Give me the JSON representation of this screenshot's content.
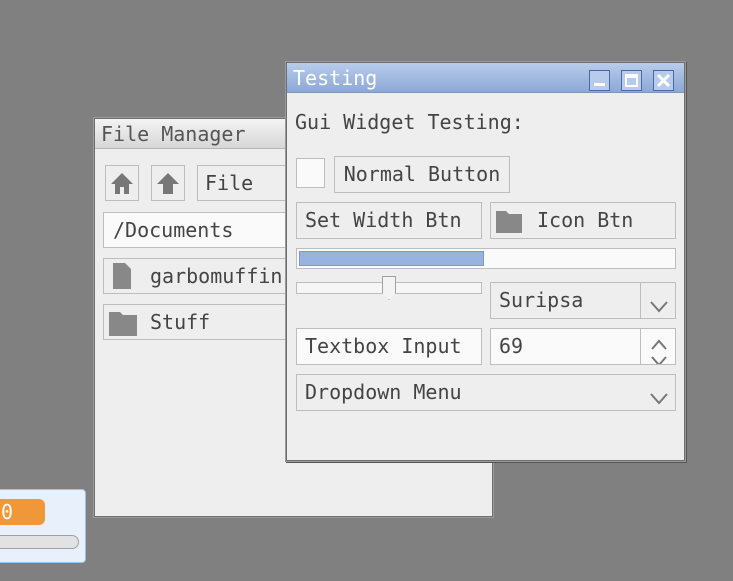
{
  "file_manager": {
    "title": "File Manager",
    "toolbar": {
      "home_icon": "home-icon",
      "up_icon": "up-arrow-icon",
      "path_field": "File"
    },
    "location": "/Documents",
    "items": [
      {
        "icon": "file-icon",
        "label": "garbomuffin"
      },
      {
        "icon": "folder-icon",
        "label": "Stuff"
      }
    ]
  },
  "testing_window": {
    "title": "Testing",
    "heading": "Gui Widget Testing:",
    "controls": {
      "minimize": "minimize-icon",
      "maximize": "maximize-icon",
      "close": "close-icon"
    },
    "normal_button": "Normal Button",
    "set_width_button": "Set Width Btn",
    "icon_button": "Icon Btn",
    "progress": 0.5,
    "slider_value": 0.5,
    "select_value": "Suripsa",
    "textbox_value": "Textbox Input",
    "number_value": "69",
    "dropdown_label": "Dropdown Menu"
  },
  "mini_widget": {
    "badge_text": "0",
    "badge_color": "#f0973a"
  },
  "colors": {
    "desktop": "#808080",
    "accent": "#98b3df",
    "titlebar_active": "#8ba8d6"
  }
}
